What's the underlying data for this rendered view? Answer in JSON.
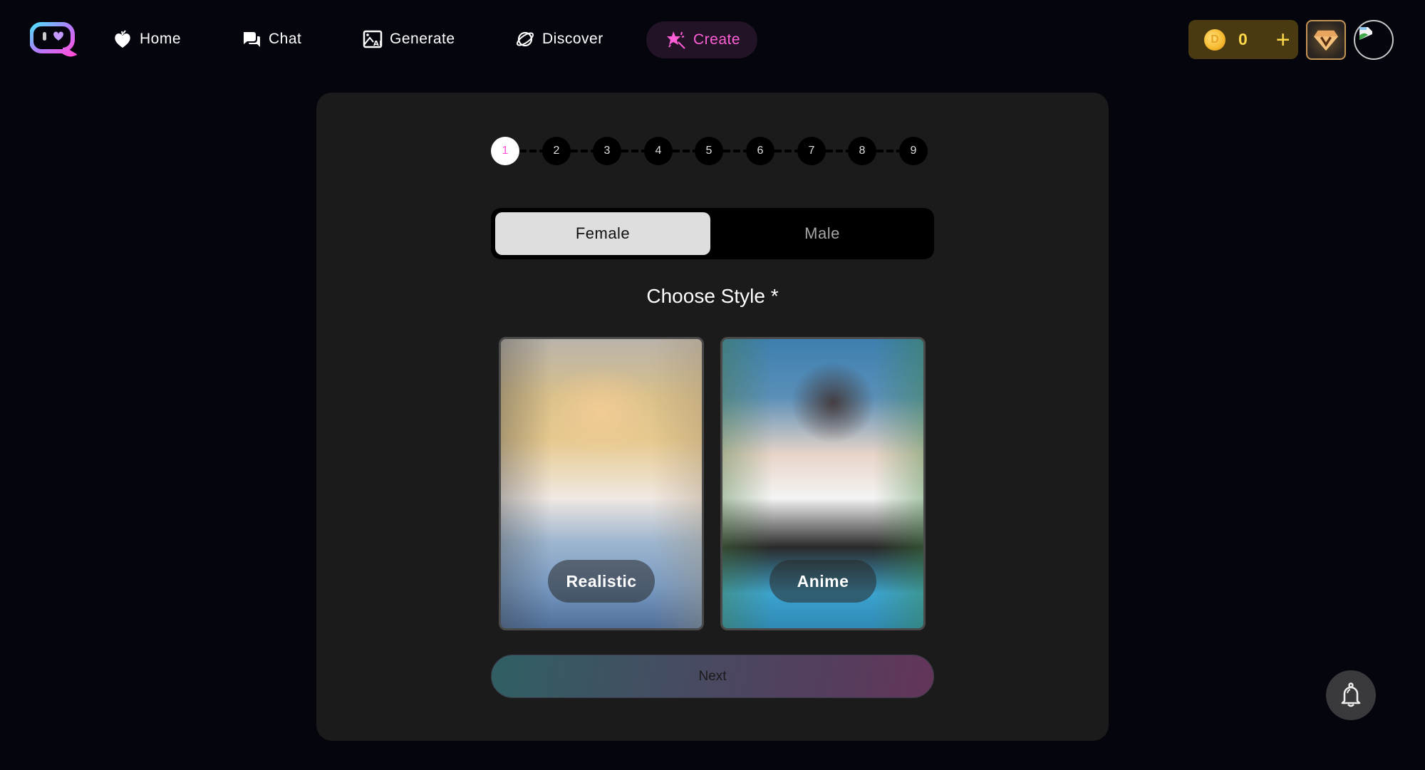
{
  "nav": {
    "logo_alt": "app-logo",
    "items": [
      {
        "label": "Home",
        "icon": "heart-fruit-icon",
        "active": false
      },
      {
        "label": "Chat",
        "icon": "chat-bubbles-icon",
        "active": false
      },
      {
        "label": "Generate",
        "icon": "ai-image-icon",
        "active": false
      },
      {
        "label": "Discover",
        "icon": "planet-icon",
        "active": true
      },
      {
        "label": "Create",
        "icon": "magic-star-icon",
        "active": true
      }
    ],
    "accent_color": "#ff5fd6"
  },
  "account": {
    "coin_count": "0",
    "coin_add_label": "+",
    "vip_icon": "diamond-v-icon",
    "avatar_icon": "broken-image-icon"
  },
  "wizard": {
    "steps": [
      "1",
      "2",
      "3",
      "4",
      "5",
      "6",
      "7",
      "8",
      "9"
    ],
    "current_step": 1,
    "gender": {
      "options": [
        "Female",
        "Male"
      ],
      "selected": "Female"
    },
    "section_title": "Choose Style *",
    "styles": [
      {
        "label": "Realistic"
      },
      {
        "label": "Anime"
      }
    ],
    "next_label": "Next"
  },
  "notifications": {
    "icon": "bell-icon"
  }
}
